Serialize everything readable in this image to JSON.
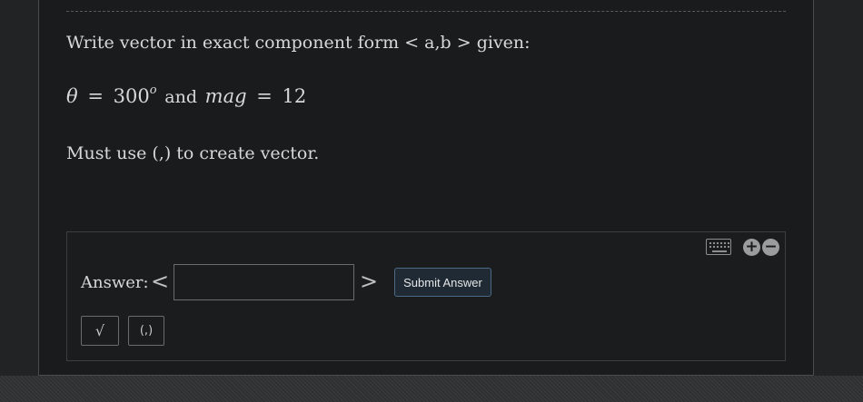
{
  "question": {
    "line1": "Write vector in exact component form < a,b > given:",
    "math": {
      "theta_symbol": "θ",
      "equals": "=",
      "angle_value": "300",
      "angle_sup": "o",
      "and_text": "and",
      "mag_symbol": "mag",
      "mag_value": "12"
    },
    "line3": "Must use (,) to create vector."
  },
  "answer": {
    "label": "Answer:",
    "left_bracket": "<",
    "right_bracket": ">",
    "input_value": "",
    "input_placeholder": "",
    "submit_label": "Submit Answer",
    "tools": {
      "sqrt_label": "√",
      "paren_label": "(,)"
    },
    "icons": {
      "keyboard": "keyboard-icon",
      "plus": "+",
      "minus": "−"
    }
  },
  "colors": {
    "page_bg": "#222325",
    "card_bg": "#1a1b1d",
    "text": "#d8d8d8",
    "submit_bg": "#1f2a35",
    "submit_border": "#4c6a86"
  }
}
